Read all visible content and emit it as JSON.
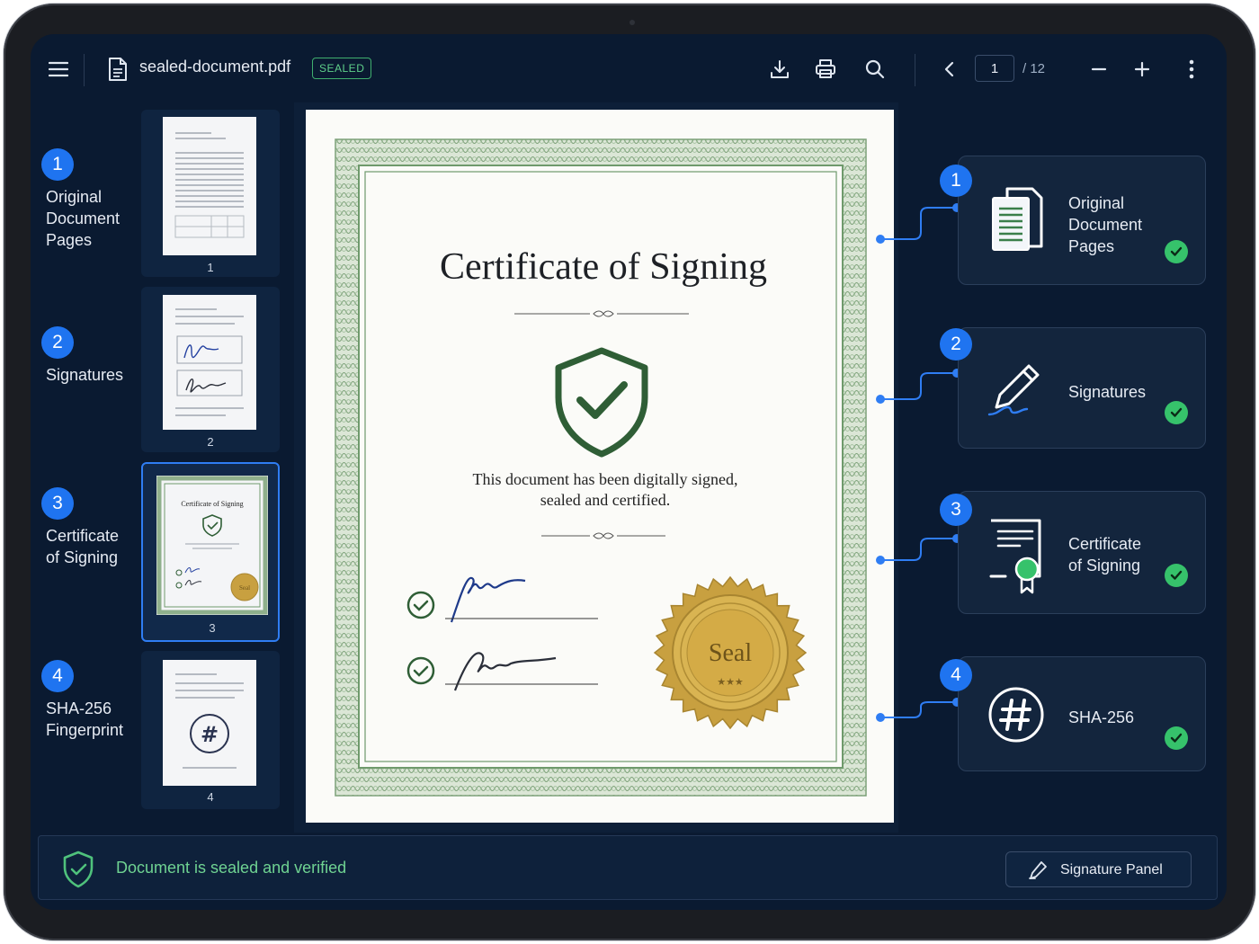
{
  "toolbar": {
    "file_name": "sealed-document.pdf",
    "badge": "SEALED",
    "page_current": "1",
    "page_total": "/ 12",
    "icons": [
      "menu-icon",
      "file-icon",
      "download-icon",
      "print-icon",
      "search-icon",
      "chevron-left-icon",
      "zoom-out-icon",
      "zoom-in-icon",
      "more-vertical-icon"
    ]
  },
  "steps": [
    {
      "number": "1",
      "label": "Original\nDocument\nPages"
    },
    {
      "number": "2",
      "label": "Signatures"
    },
    {
      "number": "3",
      "label": "Certificate\nof Signing"
    },
    {
      "number": "4",
      "label": "SHA-256\nFingerprint"
    }
  ],
  "thumbnails": [
    {
      "page": "1",
      "active": false
    },
    {
      "page": "2",
      "active": false
    },
    {
      "page": "3",
      "active": true,
      "mini_title": "Certificate of Signing",
      "mini_seal": "Seal"
    },
    {
      "page": "4",
      "active": false
    }
  ],
  "certificate": {
    "title": "Certificate of Signing",
    "line1": "This document has been digitally signed,",
    "line2": "sealed and certified.",
    "seal_text": "Seal",
    "seal_stars": "★★★",
    "colors": {
      "border": "#6f9a6c",
      "shield": "#2f5e36",
      "seal": "#c8a040",
      "ink": "#1e3a8a"
    }
  },
  "cards": [
    {
      "number": "1",
      "label": "Original\nDocument\nPages",
      "icon": "documents-icon"
    },
    {
      "number": "2",
      "label": "Signatures",
      "icon": "pen-icon"
    },
    {
      "number": "3",
      "label": "Certificate\nof Signing",
      "icon": "certificate-icon"
    },
    {
      "number": "4",
      "label": "SHA-256",
      "icon": "hash-icon"
    }
  ],
  "status": {
    "message": "Document is sealed and verified",
    "button_label": "Signature Panel"
  },
  "colors": {
    "background": "#0a1a31",
    "accent": "#1f74f0",
    "success": "#36c26b"
  }
}
